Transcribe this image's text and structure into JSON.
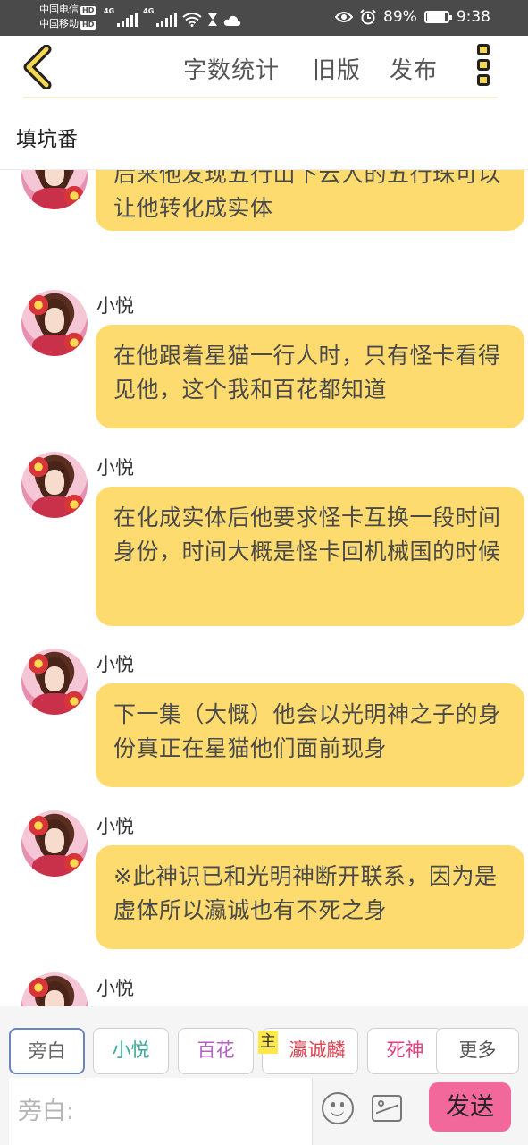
{
  "status_bar": {
    "carrier_1": "中国电信",
    "carrier_2": "中国移动",
    "hd_badge": "HD",
    "network_1": "4G",
    "network_2": "4G",
    "battery_percent": "89%",
    "time": "9:38"
  },
  "toolbar": {
    "word_count_label": "字数统计",
    "old_version_label": "旧版",
    "publish_label": "发布"
  },
  "page": {
    "title": "填坑番"
  },
  "messages": [
    {
      "sender": "",
      "text": "后来他发现五行山下云人的五行珠可以让他转化成实体"
    },
    {
      "sender": "小悦",
      "text": "在他跟着星猫一行人时，只有怪卡看得见他，这个我和百花都知道"
    },
    {
      "sender": "小悦",
      "text": "在化成实体后他要求怪卡互换一段时间身份，时间大概是怪卡回机械国的时候"
    },
    {
      "sender": "小悦",
      "text": "下一集（大慨）他会以光明神之子的身份真正在星猫他们面前现身"
    },
    {
      "sender": "小悦",
      "text": "※此神识已和光明神断开联系，因为是虚体所以瀛诚也有不死之身"
    },
    {
      "sender": "小悦",
      "text": ""
    }
  ],
  "characters": [
    {
      "label": "旁白",
      "color": "#666666"
    },
    {
      "label": "小悦",
      "color": "#3aa89b"
    },
    {
      "label": "百花",
      "color": "#b35fc4"
    },
    {
      "label": "瀛诚麟",
      "color": "#d9424f"
    },
    {
      "label": "死神",
      "color": "#e0407f"
    },
    {
      "label": "更多",
      "color": "#555555"
    }
  ],
  "host_badge": "主",
  "composer": {
    "placeholder": "旁白:",
    "send_label": "发送"
  }
}
